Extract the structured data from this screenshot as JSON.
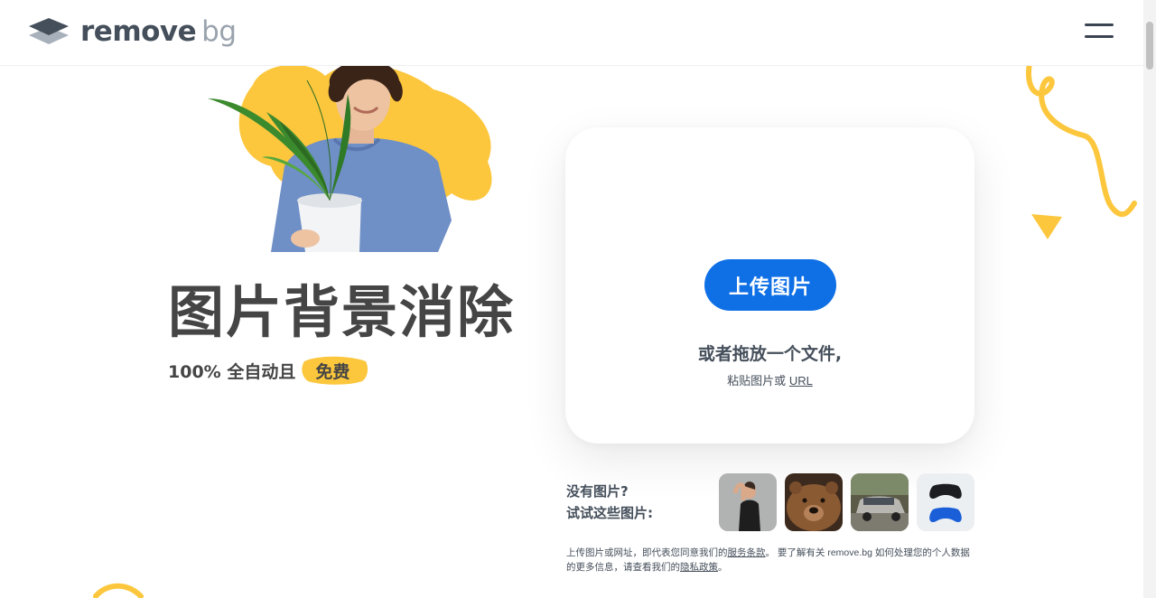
{
  "brand": {
    "name_main": "remove",
    "name_sub": "bg"
  },
  "icons": {
    "logo": "layers-logo-icon",
    "menu": "hamburger-menu-icon"
  },
  "hero": {
    "title": "图片背景消除",
    "subtitle": "100% 全自动且",
    "free_badge": "免费"
  },
  "upload": {
    "button_label": "上传图片",
    "drop_text": "或者拖放一个文件,",
    "paste_text": "粘贴图片或",
    "url_link": "URL"
  },
  "samples": {
    "line1": "没有图片?",
    "line2": "试试这些图片:",
    "items": [
      "woman-flexing",
      "brown-bear",
      "silver-suv",
      "game-controllers"
    ]
  },
  "terms": {
    "prefix": "上传图片或网址，即代表您同意我们的",
    "tos_link": "服务条款",
    "middle": "。 要了解有关 remove.bg 如何处理您的个人数据的更多信息，请查看我们的",
    "privacy_link": "隐私政策",
    "suffix": "。"
  },
  "colors": {
    "accent_blue": "#0f70e6",
    "brand_yellow": "#fcc73d",
    "text_dark": "#454545"
  }
}
